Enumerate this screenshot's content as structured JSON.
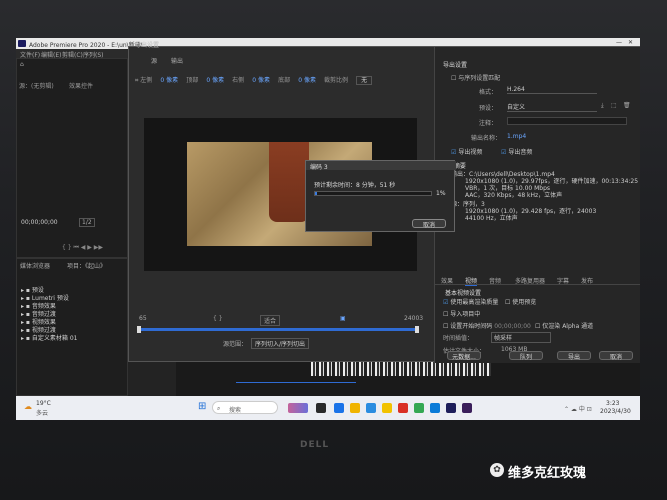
{
  "window": {
    "title": "Adobe Premiere Pro 2020 - E:\\un\\新建\\",
    "dialog_title": "导出设置"
  },
  "menu": [
    "文件(F)",
    "编辑(E)",
    "剪辑(C)",
    "序列(S)"
  ],
  "source_panel": {
    "tabs": [
      "源：(无剪辑)",
      "效果控件"
    ],
    "timecode": "00;00;00;00",
    "zoom_label": "1/2"
  },
  "preview_tabs": [
    "源",
    "输出"
  ],
  "crop_labels": [
    "左侧",
    "0 像素",
    "顶部",
    "0 像素",
    "右侧",
    "0 像素",
    "底部",
    "0 像素",
    "裁剪比例",
    "无"
  ],
  "export_settings": {
    "heading": "导出设置",
    "match_sequence": "与序列设置匹配",
    "format_label": "格式：",
    "format_value": "H.264",
    "preset_label": "预设：",
    "preset_value": "自定义",
    "comment_label": "注释：",
    "output_label": "输出名称：",
    "output_value": "1.mp4",
    "export_video": "导出视频",
    "export_audio": "导出音频",
    "summary_heading": "摘要",
    "output_line1": "输出：C:\\Users\\dell\\Desktop\\1.mp4",
    "output_line2": "1920x1080 (1.0)，29.97fps，逐行，硬件加速，00:13:34:25",
    "output_line3": "VBR，1 次，目标 10.00 Mbps",
    "output_line4": "AAC，320 Kbps，48 kHz，立体声",
    "source_line1": "源：序列，3",
    "source_line2": "1920x1080 (1.0)，29.428 fps，逐行，24003",
    "source_line3": "44100 Hz，立体声"
  },
  "settings_tabs": [
    "效果",
    "视频",
    "音频",
    "多路复用器",
    "字幕",
    "发布"
  ],
  "basic_video_settings": "基本视频设置",
  "options": {
    "max_render": "使用最高渲染质量",
    "use_preview": "使用预览",
    "import_project": "导入项目中",
    "set_start_timecode": "设置开始时间码",
    "start_timecode_value": "00;00;00;00",
    "render_alpha": "仅渲染 Alpha 通道",
    "interp_label": "时间插值：",
    "interp_value": "帧采样",
    "filesize_label": "估计文件大小：",
    "filesize_value": "1063 MB"
  },
  "buttons": {
    "metadata": "元数据...",
    "queue": "队列",
    "export": "导出",
    "cancel": "取消"
  },
  "progress_dialog": {
    "title": "编码 3",
    "remaining": "预计剩余时间：8 分钟，51 秒",
    "percent": 1,
    "percent_label": "1%",
    "cancel": "取消"
  },
  "bottom_controls": {
    "source_range_label": "源范围：",
    "source_range_value": "序列切入/序列切出",
    "fit_label": "适合"
  },
  "range_marks": {
    "start": "65",
    "end": "24003"
  },
  "right_timecode": "24003",
  "project_panel": {
    "tabs": [
      "媒体浏览器",
      "项目：《起山》"
    ],
    "items": [
      "预设",
      "Lumetri 预设",
      "音频效果",
      "音频过渡",
      "视频效果",
      "视频过渡",
      "自定义素材箱 01"
    ]
  },
  "taskbar": {
    "weather_temp": "19°C",
    "weather_desc": "多云",
    "search_placeholder": "搜索",
    "time": "3:23",
    "date": "2023/4/30"
  },
  "bezel_logo": "DELL",
  "watermark": "维多克红玫瑰",
  "colors": {
    "accent_blue": "#2f6bd3",
    "progress_fill": "#3a7be0",
    "checkbox": "#4a90d9"
  }
}
